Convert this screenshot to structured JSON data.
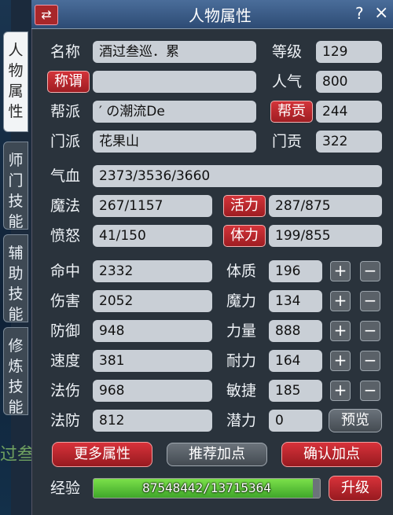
{
  "window": {
    "title": "人物属性",
    "help": "?",
    "close": "×",
    "back": "⇄"
  },
  "tabs": [
    {
      "label": "人物属性",
      "active": true
    },
    {
      "label": "师门技能",
      "active": false
    },
    {
      "label": "辅助技能",
      "active": false
    },
    {
      "label": "修炼技能",
      "active": false
    }
  ],
  "background_text": "过叁",
  "info": {
    "name_label": "名称",
    "name": "酒过叁巡．累",
    "level_label": "等级",
    "level": "129",
    "title_button": "称谓",
    "title_value": "",
    "popularity_label": "人气",
    "popularity": "800",
    "gang_label": "帮派",
    "gang": "′ の潮流De",
    "contribution_button": "帮贡",
    "contribution": "244",
    "sect_label": "门派",
    "sect": "花果山",
    "sect_contribution_label": "门贡",
    "sect_contribution": "322"
  },
  "vitals": {
    "hp_label": "气血",
    "hp": "2373/3536/3660",
    "mp_label": "魔法",
    "mp": "267/1157",
    "vitality_button": "活力",
    "vitality": "287/875",
    "rage_label": "愤怒",
    "rage": "41/150",
    "stamina_button": "体力",
    "stamina": "199/855"
  },
  "stats_left": [
    {
      "label": "命中",
      "value": "2332"
    },
    {
      "label": "伤害",
      "value": "2052"
    },
    {
      "label": "防御",
      "value": "948"
    },
    {
      "label": "速度",
      "value": "381"
    },
    {
      "label": "法伤",
      "value": "968"
    },
    {
      "label": "法防",
      "value": "812"
    }
  ],
  "stats_right": [
    {
      "label": "体质",
      "value": "196"
    },
    {
      "label": "魔力",
      "value": "134"
    },
    {
      "label": "力量",
      "value": "888"
    },
    {
      "label": "耐力",
      "value": "164"
    },
    {
      "label": "敏捷",
      "value": "185"
    },
    {
      "label": "潜力",
      "value": "0"
    }
  ],
  "plus": "+",
  "minus": "−",
  "preview_button": "预览",
  "buttons": {
    "more": "更多属性",
    "recommend": "推荐加点",
    "confirm": "确认加点"
  },
  "exp": {
    "label": "经验",
    "value": "87548442/13715364",
    "fill_fraction": 0.97,
    "upgrade_button": "升级"
  }
}
